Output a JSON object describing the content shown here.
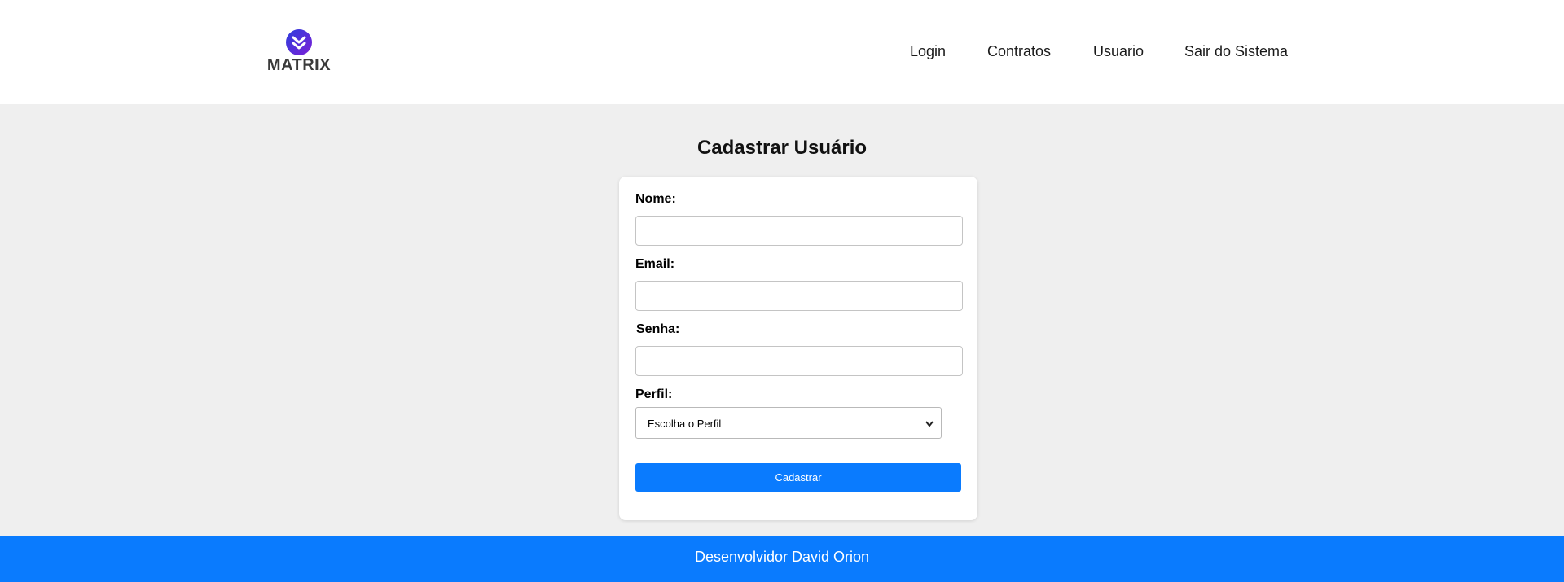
{
  "header": {
    "logo_text": "MATRIX",
    "nav": [
      "Login",
      "Contratos",
      "Usuario",
      "Sair do Sistema"
    ]
  },
  "main": {
    "title": "Cadastrar Usuário",
    "form": {
      "nome_label": "Nome:",
      "nome_value": "",
      "email_label": "Email:",
      "email_value": "",
      "senha_label": "Senha:",
      "senha_value": "",
      "perfil_label": "Perfil:",
      "perfil_selected": "Escolha o Perfil",
      "submit_label": "Cadastrar"
    }
  },
  "footer": {
    "text": "Desenvolvidor David Orion"
  },
  "colors": {
    "primary": "#0a7bfe",
    "background": "#efefef",
    "logo_gradient_start": "#2d3fdd",
    "logo_gradient_end": "#7b1fd6"
  },
  "icons": {
    "logo": "matrix-chevron-logo-icon",
    "select": "chevron-down-icon"
  }
}
